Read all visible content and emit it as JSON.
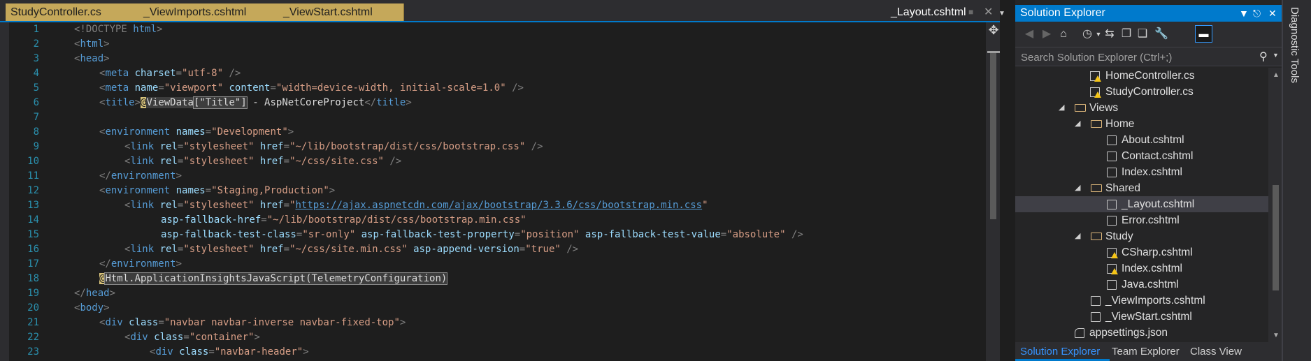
{
  "editor": {
    "tabs": [
      "StudyController.cs",
      "_ViewImports.cshtml",
      "_ViewStart.cshtml"
    ],
    "active_tab": "_Layout.cshtml",
    "line_numbers": [
      "1",
      "2",
      "3",
      "4",
      "5",
      "6",
      "7",
      "8",
      "9",
      "10",
      "11",
      "12",
      "13",
      "14",
      "15",
      "16",
      "17",
      "18",
      "19",
      "20",
      "21",
      "22",
      "23"
    ],
    "code": {
      "l1a": "<!DOCTYPE ",
      "l1b": "html",
      "l1c": ">",
      "l2a": "<",
      "l2b": "html",
      "l2c": ">",
      "l3a": "<",
      "l3b": "head",
      "l3c": ">",
      "l4a": "<",
      "l4b": "meta",
      "l4c": " charset",
      "l4d": "=",
      "l4e": "\"utf-8\"",
      "l4f": " />",
      "l5a": "<",
      "l5b": "meta",
      "l5c": " name",
      "l5d": "=",
      "l5e": "\"viewport\"",
      "l5f": " content",
      "l5g": "=",
      "l5h": "\"width=device-width, initial-scale=1.0\"",
      "l5i": " />",
      "l6a": "<",
      "l6b": "title",
      "l6c": ">",
      "l6d": "@",
      "l6e": "ViewData",
      "l6f": "[\"Title\"]",
      "l6g": " - AspNetCoreProject",
      "l6h": "</",
      "l6i": "title",
      "l6j": ">",
      "l8a": "<",
      "l8b": "environment",
      "l8c": " names",
      "l8d": "=",
      "l8e": "\"Development\"",
      "l8f": ">",
      "l9a": "<",
      "l9b": "link",
      "l9c": " rel",
      "l9d": "=",
      "l9e": "\"stylesheet\"",
      "l9f": " href",
      "l9g": "=",
      "l9h": "\"~/lib/bootstrap/dist/css/bootstrap.css\"",
      "l9i": " />",
      "l10a": "<",
      "l10b": "link",
      "l10c": " rel",
      "l10d": "=",
      "l10e": "\"stylesheet\"",
      "l10f": " href",
      "l10g": "=",
      "l10h": "\"~/css/site.css\"",
      "l10i": " />",
      "l11a": "</",
      "l11b": "environment",
      "l11c": ">",
      "l12a": "<",
      "l12b": "environment",
      "l12c": " names",
      "l12d": "=",
      "l12e": "\"Staging,Production\"",
      "l12f": ">",
      "l13a": "<",
      "l13b": "link",
      "l13c": " rel",
      "l13d": "=",
      "l13e": "\"stylesheet\"",
      "l13f": " href",
      "l13g": "=",
      "l13h": "\"",
      "l13i": "https://ajax.aspnetcdn.com/ajax/bootstrap/3.3.6/css/bootstrap.min.css",
      "l13j": "\"",
      "l14a": "asp-fallback-href",
      "l14b": "=",
      "l14c": "\"~/lib/bootstrap/dist/css/bootstrap.min.css\"",
      "l15a": "asp-fallback-test-class",
      "l15b": "=",
      "l15c": "\"sr-only\"",
      "l15d": " asp-fallback-test-property",
      "l15e": "=",
      "l15f": "\"position\"",
      "l15g": " asp-fallback-test-value",
      "l15h": "=",
      "l15i": "\"absolute\"",
      "l15j": " />",
      "l16a": "<",
      "l16b": "link",
      "l16c": " rel",
      "l16d": "=",
      "l16e": "\"stylesheet\"",
      "l16f": " href",
      "l16g": "=",
      "l16h": "\"~/css/site.min.css\"",
      "l16i": " asp-append-version",
      "l16j": "=",
      "l16k": "\"true\"",
      "l16l": " />",
      "l17a": "</",
      "l17b": "environment",
      "l17c": ">",
      "l18a": "@",
      "l18b": "Html.ApplicationInsightsJavaScript(TelemetryConfiguration)",
      "l19a": "</",
      "l19b": "head",
      "l19c": ">",
      "l20a": "<",
      "l20b": "body",
      "l20c": ">",
      "l21a": "<",
      "l21b": "div",
      "l21c": " class",
      "l21d": "=",
      "l21e": "\"navbar navbar-inverse navbar-fixed-top\"",
      "l21f": ">",
      "l22a": "<",
      "l22b": "div",
      "l22c": " class",
      "l22d": "=",
      "l22e": "\"container\"",
      "l22f": ">",
      "l23a": "<",
      "l23b": "div",
      "l23c": " class",
      "l23d": "=",
      "l23e": "\"navbar-header\"",
      "l23f": ">"
    }
  },
  "solution_explorer": {
    "title": "Solution Explorer",
    "search_placeholder": "Search Solution Explorer (Ctrl+;)",
    "tree": [
      {
        "label": "HomeController.cs"
      },
      {
        "label": "StudyController.cs"
      },
      {
        "label": "Views"
      },
      {
        "label": "Home"
      },
      {
        "label": "About.cshtml"
      },
      {
        "label": "Contact.cshtml"
      },
      {
        "label": "Index.cshtml"
      },
      {
        "label": "Shared"
      },
      {
        "label": "_Layout.cshtml"
      },
      {
        "label": "Error.cshtml"
      },
      {
        "label": "Study"
      },
      {
        "label": "CSharp.cshtml"
      },
      {
        "label": "Index.cshtml"
      },
      {
        "label": "Java.cshtml"
      },
      {
        "label": "_ViewImports.cshtml"
      },
      {
        "label": "_ViewStart.cshtml"
      },
      {
        "label": "appsettings.json"
      }
    ],
    "bottom_tabs": [
      "Solution Explorer",
      "Team Explorer",
      "Class View"
    ]
  },
  "side_panel": {
    "label": "Diagnostic Tools"
  },
  "colors": {
    "accent": "#007acc",
    "tab_gold": "#c5a85a",
    "tag": "#569cd6",
    "attr": "#9cdcfe",
    "value": "#d69d85",
    "line_number": "#2b91af"
  }
}
